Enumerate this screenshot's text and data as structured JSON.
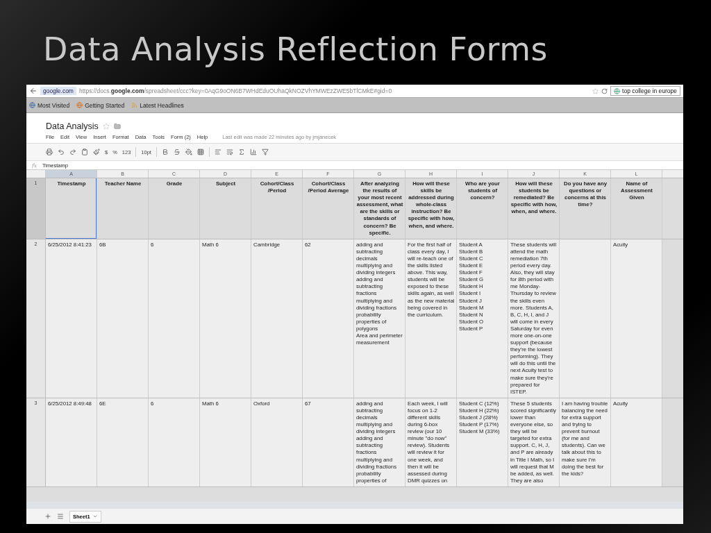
{
  "slide_title": "Data Analysis Reflection Forms",
  "browser": {
    "site": "google.com",
    "url": "https://docs.**google.com**/spreadsheet/ccc?key=0AqG9oON6B7WHdEduOUhaQkNOZVhYMWEzZWE5bTlCMkE#gid=0",
    "search": "top college in europe"
  },
  "bookmarks": [
    "Most Visited",
    "Getting Started",
    "Latest Headlines"
  ],
  "doc": {
    "title": "Data Analysis",
    "menu": [
      "File",
      "Edit",
      "View",
      "Insert",
      "Format",
      "Data",
      "Tools",
      "Form (2)",
      "Help"
    ],
    "last_edit": "Last edit was made 22 minutes ago by jmjanecek"
  },
  "toolbar": {
    "currency": "$",
    "percent": "%",
    "number_format": "123",
    "font_size": "10pt"
  },
  "formula_bar": {
    "label": "fx",
    "value": "Timestamp"
  },
  "columns": [
    {
      "label": "A",
      "selected": true
    },
    {
      "label": "B",
      "selected": false
    },
    {
      "label": "C",
      "selected": false
    },
    {
      "label": "D",
      "selected": false
    },
    {
      "label": "E",
      "selected": false
    },
    {
      "label": "F",
      "selected": false
    },
    {
      "label": "G",
      "selected": false
    },
    {
      "label": "H",
      "selected": false
    },
    {
      "label": "I",
      "selected": false
    },
    {
      "label": "J",
      "selected": false
    },
    {
      "label": "K",
      "selected": false
    },
    {
      "label": "L",
      "selected": false
    }
  ],
  "rows": [
    {
      "number": "1",
      "header": true,
      "cells": [
        "Timestamp",
        "Teacher Name",
        "Grade",
        "Subject",
        "Cohort/Class /Period",
        "Cohort/Class /Period Average",
        "After analyzing the results of your most recent assessment, what are the skills or standards of concern? Be specific.",
        "How will these skills be addressed during whole-class instruction? Be specific with how, when, and where.",
        "Who are your students of concern?",
        "How will these students be remediated? Be specific with how, when, and where.",
        "Do you have any questions or concerns at this time?",
        "Name of Assessment Given"
      ]
    },
    {
      "number": "2",
      "header": false,
      "cells": [
        "6/25/2012 8:41:23",
        "6B",
        "6",
        "Math 6",
        "Cambridge",
        "62",
        "adding and subtracting decimals\nmultiplying and dividing integers\nadding and subtracting fractions\nmultiplying and dividing fractions\nprobability\nproperties of polygons\nArea and perimeter measurement",
        "For the first half of class every day, I will re-teach one of the skills listed above. This way, students will be exposed to these skills again, as well as the new material being covered in the curriculum.",
        "Student A\nStudent B\nStudent C\nStudent E\nStudent F\nStudent G\nStudent H\nStudent I\nStudent J\nStudent M\nStudent N\nStudent O\nStudent P",
        "These students will attend the math remediation 7th period every day. Also, they will stay for 8th period with me Monday-Thursday to review the skills even more. Students A, B, C, H, I, and J will come in every Saturday for even more one-on-one support (because they're the lowest performing). They will do this until the next Acuity test to make sure they're prepared for ISTEP.",
        "",
        "Acuity"
      ]
    },
    {
      "number": "3",
      "header": false,
      "cells": [
        "6/25/2012 8:49:48",
        "6E",
        "6",
        "Math 6",
        "Oxford",
        "67",
        "adding and subtracting decimals\nmultiplying and dividing integers\nadding and subtracting fractions\nmultiplying and dividing fractions\nprobability\nproperties of",
        "Each week, I will focus on 1-2 different skills during 6-box review (our 10 minute \"do now\" review). Students will review it for one week, and then it will be assessed during DMR quizzes on",
        "Student C (12%)\nStudent H (22%)\nStudent J (28%)\nStudent P (17%)\nStudent M (33%)",
        "These 5 students scored significantly lower than everyone else, so they will be targeted for extra support. C, H, J, and P are already in Title I Math, so I will request that M be added, as well. They are also",
        "I am having trouble balancing the need for extra support and trying to prevent burnout (for me and students). Can we talk about this to make sure I'm doing the best for the kids?",
        "Acuity"
      ]
    }
  ],
  "sheet_tab": "Sheet1"
}
